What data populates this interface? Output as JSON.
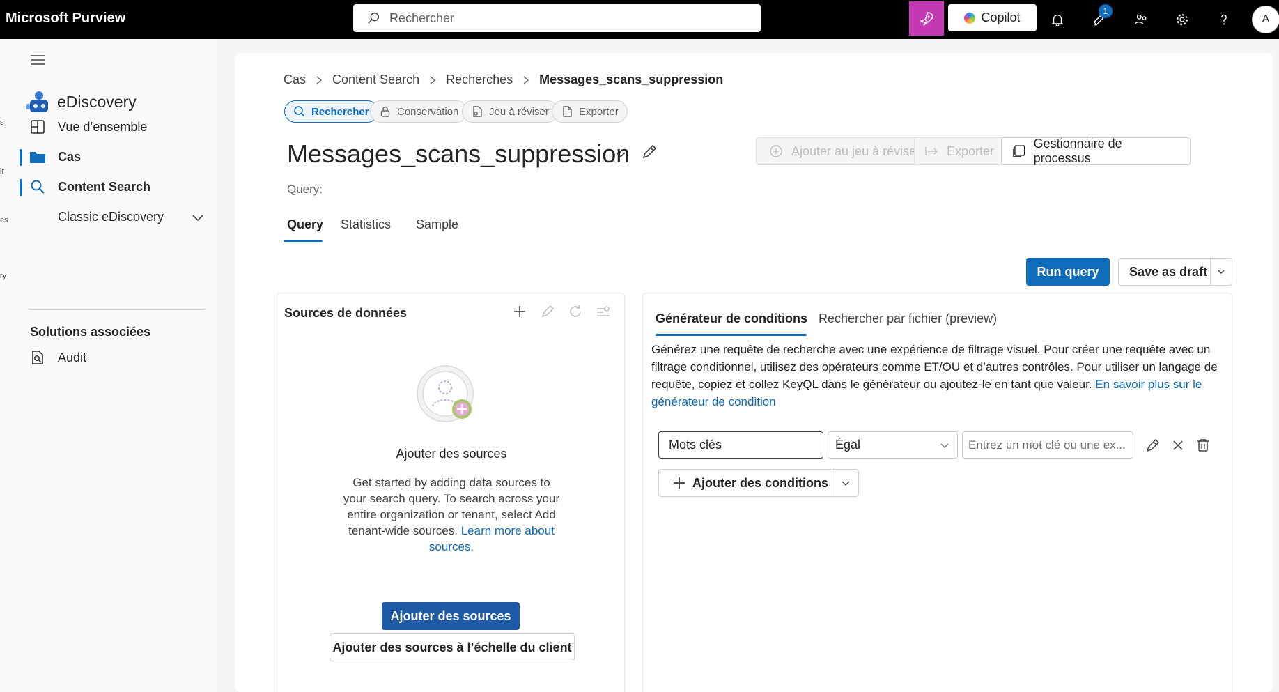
{
  "topbar": {
    "brand": "Microsoft Purview",
    "search_placeholder": "Rechercher",
    "copilot_label": "Copilot",
    "notification_count": "1",
    "avatar_initial": "A"
  },
  "edge_fragments": [
    "s",
    "ir",
    "es",
    "ry"
  ],
  "sidebar": {
    "app_title": "eDiscovery",
    "items": [
      {
        "label": "Vue d’ensemble"
      },
      {
        "label": "Cas"
      },
      {
        "label": "Content Search"
      },
      {
        "label": "Classic eDiscovery"
      }
    ],
    "section_title": "Solutions associées",
    "related": [
      {
        "label": "Audit"
      }
    ]
  },
  "breadcrumb": [
    "Cas",
    "Content Search",
    "Recherches",
    "Messages_scans_suppression"
  ],
  "pills": [
    "Rechercher",
    "Conservation",
    "Jeu à réviser",
    "Exporter"
  ],
  "page": {
    "title": "Messages_scans_suppression",
    "query_label": "Query:",
    "add_to_review_label": "Ajouter au jeu à réviser",
    "export_label": "Exporter",
    "process_manager_label": "Gestionnaire de processus"
  },
  "tabs": [
    "Query",
    "Statistics",
    "Sample"
  ],
  "actions": {
    "run_query": "Run query",
    "save_draft": "Save as draft"
  },
  "sources_panel": {
    "title": "Sources de données",
    "empty_title": "Ajouter des sources",
    "empty_desc": "Get started by adding data sources to your search query. To search across your entire organization or tenant, select Add tenant-wide sources.",
    "learn_more": "Learn more about sources.",
    "add_sources_button": "Ajouter des sources",
    "add_tenant_sources_button": "Ajouter des sources à l’échelle du client"
  },
  "conditions_panel": {
    "tabs": [
      "Générateur de conditions",
      "Rechercher par fichier (preview)"
    ],
    "description": "Générez une requête de recherche avec une expérience de filtrage visuel. Pour créer une requête avec un filtrage conditionnel, utilisez des opérateurs comme ET/OU et d’autres contrôles. Pour utiliser un langage de requête, copiez et collez KeyQL dans le générateur ou ajoutez-le en tant que valeur.",
    "learn_more": "En savoir plus sur le générateur de condition",
    "condition": {
      "field": "Mots clés",
      "operator": "Égal",
      "value_placeholder": "Entrez un mot clé ou une ex..."
    },
    "add_conditions_label": "Ajouter des conditions"
  },
  "colors": {
    "accent": "#0f6cbd",
    "copilot_tile": "#c239b3",
    "topbar": "#000000"
  }
}
